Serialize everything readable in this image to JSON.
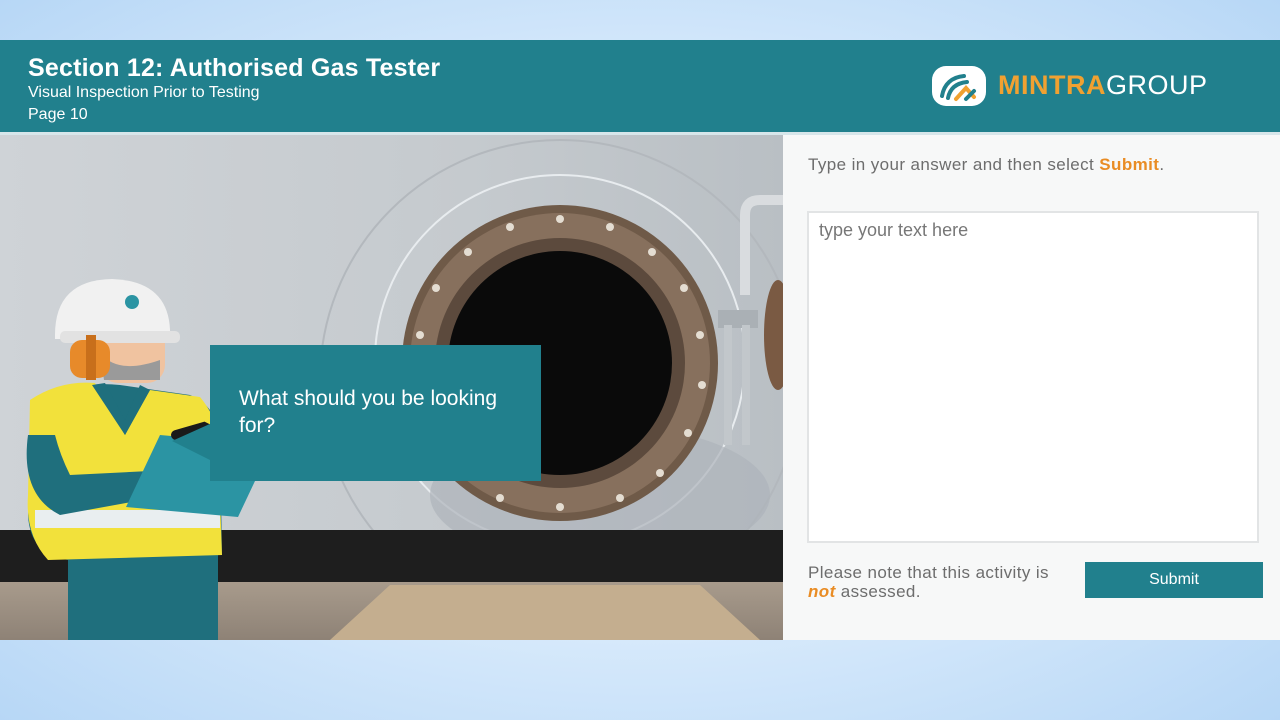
{
  "header": {
    "title": "Section 12: Authorised Gas Tester",
    "subtitle": "Visual Inspection Prior to Testing",
    "page": "Page 10"
  },
  "logo": {
    "brand_part1": "MINTRA",
    "brand_part2": "GROUP",
    "icon": "mintra-logo-icon"
  },
  "scene": {
    "question": "What should you be looking for?"
  },
  "panel": {
    "instruction_prefix": "Type in your answer and then select",
    "instruction_highlight": "Submit",
    "instruction_suffix": ".",
    "answer_placeholder": "type your text here",
    "answer_value": "",
    "note_prefix": "Please note that this activity is",
    "note_highlight": "not",
    "note_suffix": "assessed.",
    "submit_label": "Submit"
  },
  "colors": {
    "teal": "#21808d",
    "orange": "#e98c24",
    "brand_orange": "#f0a131"
  }
}
